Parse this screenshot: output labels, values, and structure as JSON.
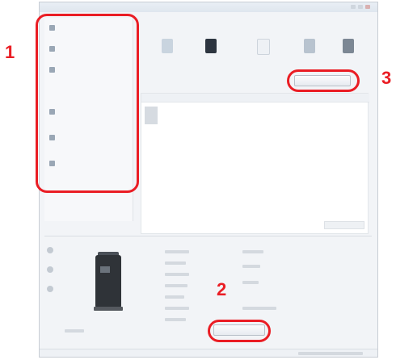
{
  "callouts": {
    "one": "1",
    "two": "2",
    "three": "3"
  },
  "colors": {
    "callout": "#ea1d24",
    "window_bg": "#f2f4f7",
    "printer_body": "#2f3338"
  },
  "icons": [
    "printer-icon",
    "toner-icon",
    "document-icon",
    "network-icon",
    "device-icon"
  ]
}
